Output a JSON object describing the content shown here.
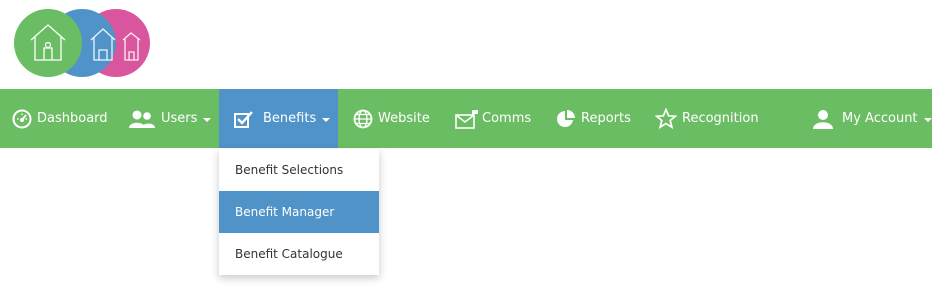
{
  "brand": {
    "logo_icon": "house-people-icon",
    "colors": [
      "#6bbd63",
      "#4f93c9",
      "#d9559e"
    ]
  },
  "nav": {
    "items": [
      {
        "label": "Dashboard",
        "icon": "speedometer-icon"
      },
      {
        "label": "Users",
        "icon": "users-icon",
        "has_caret": true
      },
      {
        "label": "Benefits",
        "icon": "checkbox-icon",
        "has_caret": true,
        "active": true
      },
      {
        "label": "Website",
        "icon": "globe-icon"
      },
      {
        "label": "Comms",
        "icon": "envelope-icon"
      },
      {
        "label": "Reports",
        "icon": "pie-chart-icon"
      },
      {
        "label": "Recognition",
        "icon": "star-icon"
      },
      {
        "label": "My Account",
        "icon": "user-icon",
        "has_caret": true
      }
    ]
  },
  "benefits_menu": {
    "items": [
      {
        "label": "Benefit Selections"
      },
      {
        "label": "Benefit Manager",
        "selected": true
      },
      {
        "label": "Benefit Catalogue"
      }
    ]
  },
  "colors": {
    "nav_bg": "#6bbd63",
    "active_bg": "#4f93c9",
    "text_on_nav": "#ffffff"
  }
}
